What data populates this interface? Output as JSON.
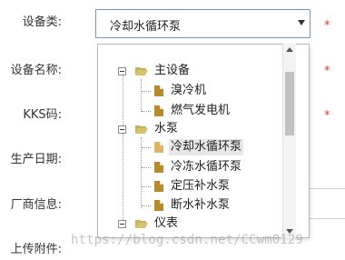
{
  "form": {
    "labels": {
      "equipment_type": "设备类:",
      "equipment_name": "设备名称:",
      "kks_code": "KKS码:",
      "production_date": "生产日期:",
      "manufacturer_info": "厂商信息:",
      "upload_attachment": "上传附件:"
    },
    "required_mark": "*",
    "equipment_type_value": "冷却水循环泵"
  },
  "tree": {
    "nodes": [
      {
        "label": "主设备",
        "type": "folder",
        "expanded": true
      },
      {
        "label": "溴冷机",
        "type": "file"
      },
      {
        "label": "燃气发电机",
        "type": "file"
      },
      {
        "label": "水泵",
        "type": "folder",
        "expanded": true
      },
      {
        "label": "冷却水循环泵",
        "type": "file",
        "selected": true
      },
      {
        "label": "冷冻水循环泵",
        "type": "file"
      },
      {
        "label": "定压补水泵",
        "type": "file"
      },
      {
        "label": "断水补水泵",
        "type": "file"
      },
      {
        "label": "仪表",
        "type": "folder",
        "expanded": true
      }
    ]
  },
  "colors": {
    "required": "#e53935",
    "select_border": "#6f95c8",
    "folder_icon": "#c8b15a",
    "file_icon": "#b58a2c",
    "selected_bg": "#e7e7e7"
  },
  "watermark": "https://blog.csdn.net/CCwm0129"
}
